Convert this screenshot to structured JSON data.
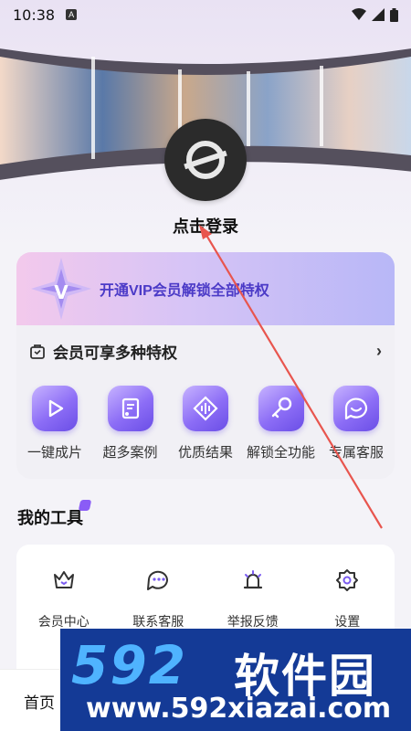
{
  "status_bar": {
    "time": "10:38",
    "notif": "A"
  },
  "profile": {
    "login_label": "点击登录"
  },
  "vip": {
    "banner_title": "开通VIP会员解锁全部特权",
    "subheader": "会员可享多种特权",
    "privileges": [
      {
        "label": "一键成片",
        "icon": "play-icon"
      },
      {
        "label": "超多案例",
        "icon": "document-star-icon"
      },
      {
        "label": "优质结果",
        "icon": "diamond-wave-icon"
      },
      {
        "label": "解锁全功能",
        "icon": "key-icon"
      },
      {
        "label": "专属客服",
        "icon": "chat-smile-icon"
      }
    ]
  },
  "tools": {
    "title": "我的工具",
    "items": [
      {
        "label": "会员中心",
        "icon": "crown-icon"
      },
      {
        "label": "联系客服",
        "icon": "chat-bubble-icon"
      },
      {
        "label": "举报反馈",
        "icon": "alarm-light-icon"
      },
      {
        "label": "设置",
        "icon": "gear-icon"
      }
    ]
  },
  "bottom_nav": {
    "home_label": "首页"
  },
  "watermark": {
    "logo": "592",
    "brand": "软件园",
    "url": "www.592xiazai.com"
  },
  "colors": {
    "accent": "#7b5cf0",
    "banner_text": "#4b3ac7",
    "watermark_bg": "#143a96",
    "arrow": "#e8554e"
  }
}
